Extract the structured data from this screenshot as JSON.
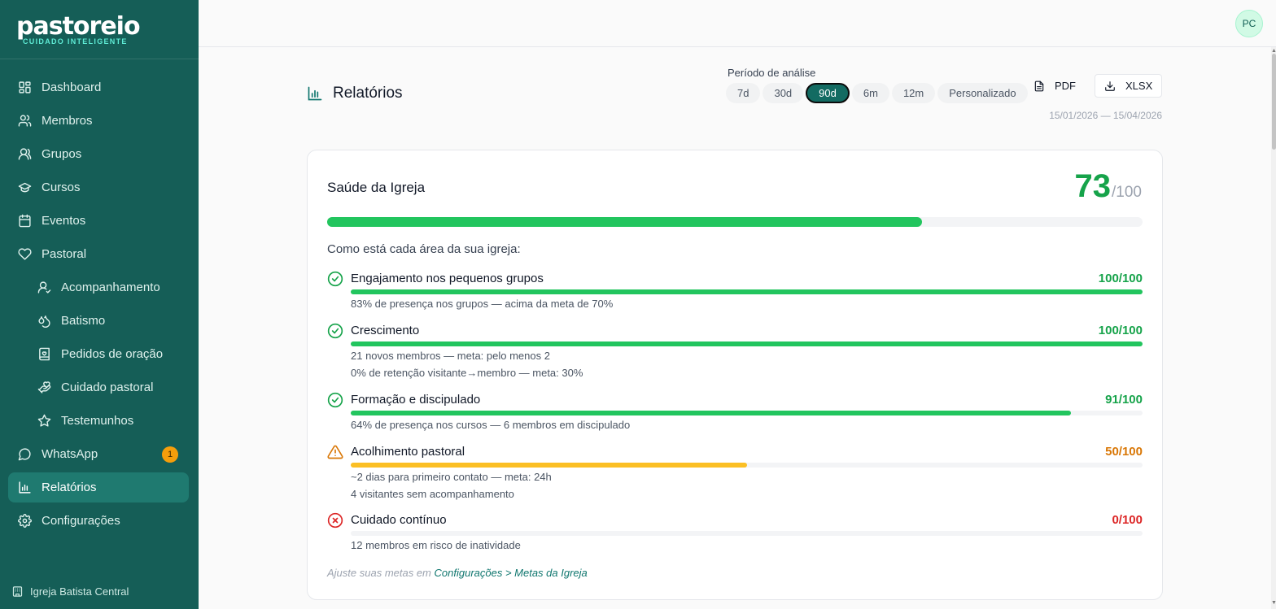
{
  "brand": {
    "name": "pastoreio",
    "tagline": "CUIDADO INTELIGENTE"
  },
  "colors": {
    "sidebar": "#155e57",
    "accent": "#136b62",
    "success": "#22c55e",
    "warning": "#f59e0b",
    "danger": "#dc2626"
  },
  "sidebar": {
    "items": [
      {
        "label": "Dashboard",
        "icon": "dashboard-icon"
      },
      {
        "label": "Membros",
        "icon": "users-icon"
      },
      {
        "label": "Grupos",
        "icon": "group-icon"
      },
      {
        "label": "Cursos",
        "icon": "graduation-cap-icon"
      },
      {
        "label": "Eventos",
        "icon": "calendar-icon"
      },
      {
        "label": "Pastoral",
        "icon": "heart-icon"
      },
      {
        "label": "Acompanhamento",
        "icon": "user-check-icon",
        "sub": true
      },
      {
        "label": "Batismo",
        "icon": "droplets-icon",
        "sub": true
      },
      {
        "label": "Pedidos de oração",
        "icon": "book-heart-icon",
        "sub": true
      },
      {
        "label": "Cuidado pastoral",
        "icon": "hand-heart-icon",
        "sub": true
      },
      {
        "label": "Testemunhos",
        "icon": "star-icon",
        "sub": true
      },
      {
        "label": "WhatsApp",
        "icon": "message-circle-icon",
        "badge": "1"
      },
      {
        "label": "Relatórios",
        "icon": "bar-chart-icon",
        "active": true
      },
      {
        "label": "Configurações",
        "icon": "gear-icon"
      }
    ],
    "church": "Igreja Batista Central"
  },
  "topbar": {
    "avatar": "PC"
  },
  "header": {
    "title": "Relatórios",
    "period_label": "Período de análise",
    "periods": [
      "7d",
      "30d",
      "90d",
      "6m",
      "12m",
      "Personalizado"
    ],
    "active_period": "90d",
    "pdf_label": "PDF",
    "xlsx_label": "XLSX",
    "date_range": "15/01/2026 — 15/04/2026"
  },
  "health": {
    "title": "Saúde da Igreja",
    "score": "73",
    "score_max": "/100",
    "score_fraction": 0.73,
    "subtitle": "Como está cada área da sua igreja:",
    "areas": [
      {
        "name": "Engajamento nos pequenos grupos",
        "score": "100/100",
        "value": 100,
        "status": "ok",
        "details": [
          "83% de presença nos grupos — acima da meta de 70%"
        ]
      },
      {
        "name": "Crescimento",
        "score": "100/100",
        "value": 100,
        "status": "ok",
        "details": [
          "21 novos membros — meta: pelo menos 2",
          "0% de retenção visitante→membro — meta: 30%"
        ]
      },
      {
        "name": "Formação e discipulado",
        "score": "91/100",
        "value": 91,
        "status": "ok",
        "details": [
          "64% de presença nos cursos — 6 membros em discipulado"
        ]
      },
      {
        "name": "Acolhimento pastoral",
        "score": "50/100",
        "value": 50,
        "status": "warn",
        "details": [
          "~2 dias para primeiro contato — meta: 24h",
          "4 visitantes sem acompanhamento"
        ]
      },
      {
        "name": "Cuidado contínuo",
        "score": "0/100",
        "value": 0,
        "status": "bad",
        "details": [
          "12 membros em risco de inatividade"
        ]
      }
    ],
    "footer_prefix": "Ajuste suas metas em",
    "footer_link": "Configurações > Metas da Igreja"
  }
}
